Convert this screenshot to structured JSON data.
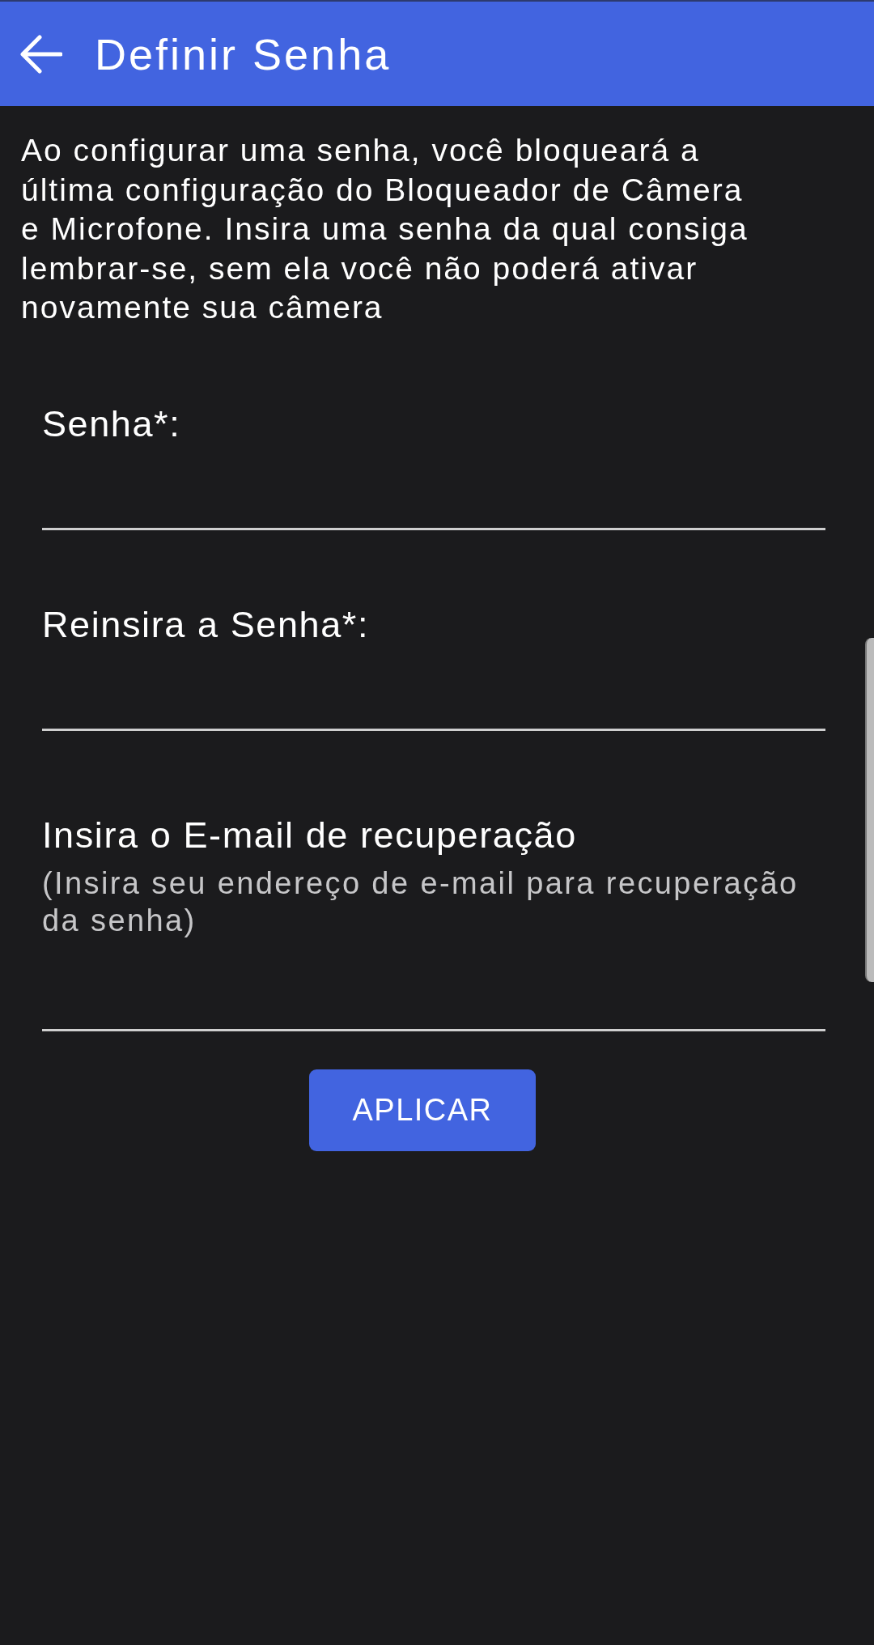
{
  "app_bar": {
    "title": "Definir Senha"
  },
  "description": "Ao configurar uma senha, você bloqueará a última configuração do Bloqueador de Câmera e Microfone. Insira uma senha da qual consiga lembrar-se, sem ela você não poderá ativar novamente sua câmera",
  "fields": [
    {
      "label": "Senha*:"
    },
    {
      "label": "Reinsira a Senha*:"
    },
    {
      "label": "Insira o E-mail de recuperação",
      "hint": "(Insira seu endereço de e-mail para recuperação da senha)"
    }
  ],
  "button": {
    "label": "APLICAR"
  }
}
